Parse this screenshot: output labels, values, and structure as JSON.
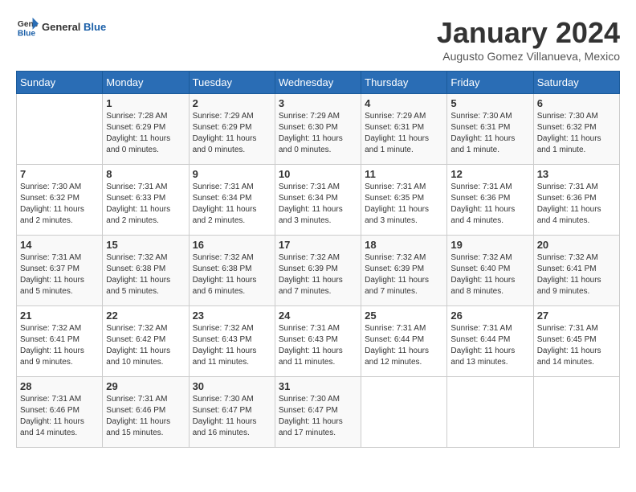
{
  "logo": {
    "general": "General",
    "blue": "Blue"
  },
  "title": "January 2024",
  "subtitle": "Augusto Gomez Villanueva, Mexico",
  "weekdays": [
    "Sunday",
    "Monday",
    "Tuesday",
    "Wednesday",
    "Thursday",
    "Friday",
    "Saturday"
  ],
  "weeks": [
    [
      {
        "day": "",
        "info": ""
      },
      {
        "day": "1",
        "info": "Sunrise: 7:28 AM\nSunset: 6:29 PM\nDaylight: 11 hours\nand 0 minutes."
      },
      {
        "day": "2",
        "info": "Sunrise: 7:29 AM\nSunset: 6:29 PM\nDaylight: 11 hours\nand 0 minutes."
      },
      {
        "day": "3",
        "info": "Sunrise: 7:29 AM\nSunset: 6:30 PM\nDaylight: 11 hours\nand 0 minutes."
      },
      {
        "day": "4",
        "info": "Sunrise: 7:29 AM\nSunset: 6:31 PM\nDaylight: 11 hours\nand 1 minute."
      },
      {
        "day": "5",
        "info": "Sunrise: 7:30 AM\nSunset: 6:31 PM\nDaylight: 11 hours\nand 1 minute."
      },
      {
        "day": "6",
        "info": "Sunrise: 7:30 AM\nSunset: 6:32 PM\nDaylight: 11 hours\nand 1 minute."
      }
    ],
    [
      {
        "day": "7",
        "info": "Sunrise: 7:30 AM\nSunset: 6:32 PM\nDaylight: 11 hours\nand 2 minutes."
      },
      {
        "day": "8",
        "info": "Sunrise: 7:31 AM\nSunset: 6:33 PM\nDaylight: 11 hours\nand 2 minutes."
      },
      {
        "day": "9",
        "info": "Sunrise: 7:31 AM\nSunset: 6:34 PM\nDaylight: 11 hours\nand 2 minutes."
      },
      {
        "day": "10",
        "info": "Sunrise: 7:31 AM\nSunset: 6:34 PM\nDaylight: 11 hours\nand 3 minutes."
      },
      {
        "day": "11",
        "info": "Sunrise: 7:31 AM\nSunset: 6:35 PM\nDaylight: 11 hours\nand 3 minutes."
      },
      {
        "day": "12",
        "info": "Sunrise: 7:31 AM\nSunset: 6:36 PM\nDaylight: 11 hours\nand 4 minutes."
      },
      {
        "day": "13",
        "info": "Sunrise: 7:31 AM\nSunset: 6:36 PM\nDaylight: 11 hours\nand 4 minutes."
      }
    ],
    [
      {
        "day": "14",
        "info": "Sunrise: 7:31 AM\nSunset: 6:37 PM\nDaylight: 11 hours\nand 5 minutes."
      },
      {
        "day": "15",
        "info": "Sunrise: 7:32 AM\nSunset: 6:38 PM\nDaylight: 11 hours\nand 5 minutes."
      },
      {
        "day": "16",
        "info": "Sunrise: 7:32 AM\nSunset: 6:38 PM\nDaylight: 11 hours\nand 6 minutes."
      },
      {
        "day": "17",
        "info": "Sunrise: 7:32 AM\nSunset: 6:39 PM\nDaylight: 11 hours\nand 7 minutes."
      },
      {
        "day": "18",
        "info": "Sunrise: 7:32 AM\nSunset: 6:39 PM\nDaylight: 11 hours\nand 7 minutes."
      },
      {
        "day": "19",
        "info": "Sunrise: 7:32 AM\nSunset: 6:40 PM\nDaylight: 11 hours\nand 8 minutes."
      },
      {
        "day": "20",
        "info": "Sunrise: 7:32 AM\nSunset: 6:41 PM\nDaylight: 11 hours\nand 9 minutes."
      }
    ],
    [
      {
        "day": "21",
        "info": "Sunrise: 7:32 AM\nSunset: 6:41 PM\nDaylight: 11 hours\nand 9 minutes."
      },
      {
        "day": "22",
        "info": "Sunrise: 7:32 AM\nSunset: 6:42 PM\nDaylight: 11 hours\nand 10 minutes."
      },
      {
        "day": "23",
        "info": "Sunrise: 7:32 AM\nSunset: 6:43 PM\nDaylight: 11 hours\nand 11 minutes."
      },
      {
        "day": "24",
        "info": "Sunrise: 7:31 AM\nSunset: 6:43 PM\nDaylight: 11 hours\nand 11 minutes."
      },
      {
        "day": "25",
        "info": "Sunrise: 7:31 AM\nSunset: 6:44 PM\nDaylight: 11 hours\nand 12 minutes."
      },
      {
        "day": "26",
        "info": "Sunrise: 7:31 AM\nSunset: 6:44 PM\nDaylight: 11 hours\nand 13 minutes."
      },
      {
        "day": "27",
        "info": "Sunrise: 7:31 AM\nSunset: 6:45 PM\nDaylight: 11 hours\nand 14 minutes."
      }
    ],
    [
      {
        "day": "28",
        "info": "Sunrise: 7:31 AM\nSunset: 6:46 PM\nDaylight: 11 hours\nand 14 minutes."
      },
      {
        "day": "29",
        "info": "Sunrise: 7:31 AM\nSunset: 6:46 PM\nDaylight: 11 hours\nand 15 minutes."
      },
      {
        "day": "30",
        "info": "Sunrise: 7:30 AM\nSunset: 6:47 PM\nDaylight: 11 hours\nand 16 minutes."
      },
      {
        "day": "31",
        "info": "Sunrise: 7:30 AM\nSunset: 6:47 PM\nDaylight: 11 hours\nand 17 minutes."
      },
      {
        "day": "",
        "info": ""
      },
      {
        "day": "",
        "info": ""
      },
      {
        "day": "",
        "info": ""
      }
    ]
  ]
}
